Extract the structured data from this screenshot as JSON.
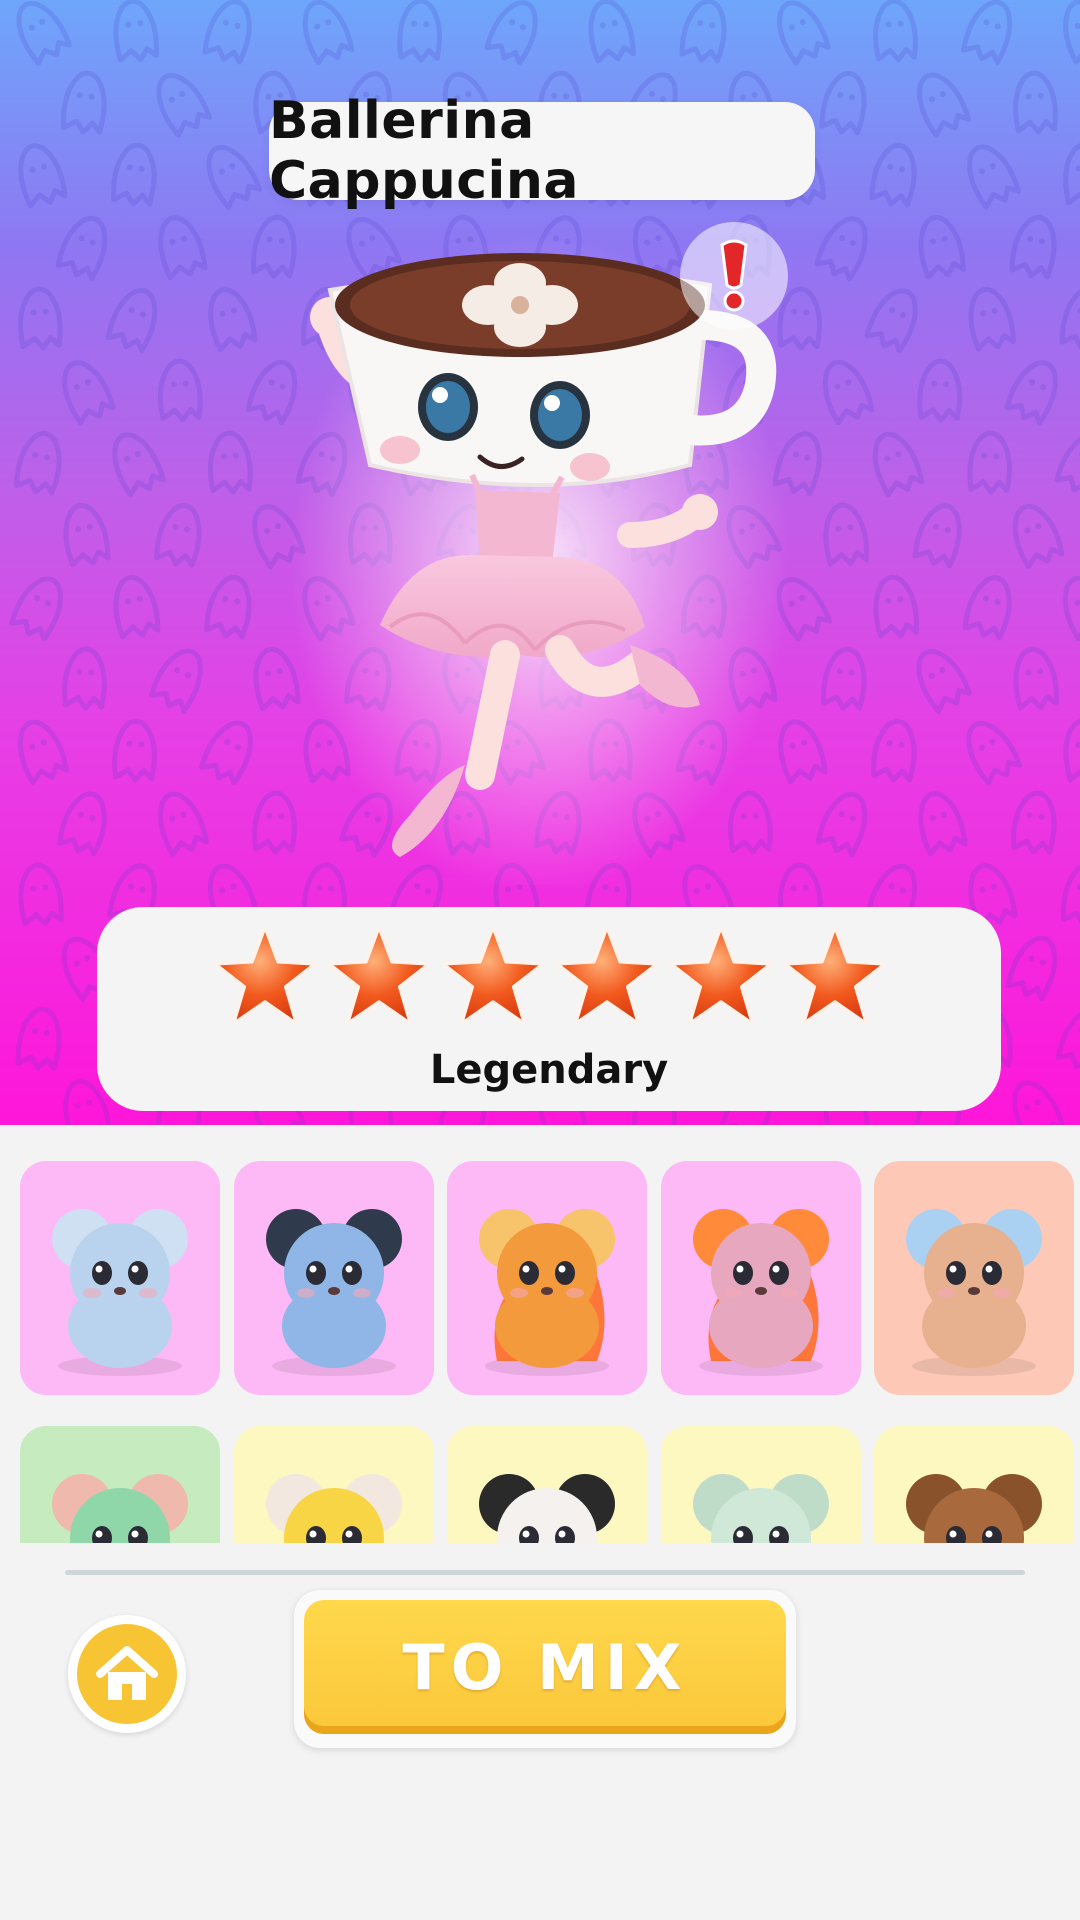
{
  "character": {
    "name": "Ballerina Cappucina",
    "rarity": "Legendary",
    "stars": 6,
    "image_icon": "ballerina-cappuccino-character",
    "info_icon": "exclamation-icon"
  },
  "colors": {
    "background_top": "#6ea6fb",
    "background_bottom": "#ff16d9",
    "star": "#f25a1e",
    "button": "#fbc73a",
    "panel": "#f4f4f5"
  },
  "collection": {
    "rows": [
      [
        {
          "icon": "ice-mouse",
          "bg": "#fdb9f6"
        },
        {
          "icon": "ice-panda",
          "bg": "#fdb9f6"
        },
        {
          "icon": "fire-tiger",
          "bg": "#fdb9f6"
        },
        {
          "icon": "fire-bird",
          "bg": "#fdb9f6"
        },
        {
          "icon": "ice-fox",
          "bg": "#fec8b6"
        }
      ],
      [
        {
          "icon": "green-mouse",
          "bg": "#c6ebbe"
        },
        {
          "icon": "strawberry-chick",
          "bg": "#fdf7c0"
        },
        {
          "icon": "tiger-cub",
          "bg": "#fdf7c0"
        },
        {
          "icon": "mint-mouse",
          "bg": "#fdf7c0"
        },
        {
          "icon": "brown-bear",
          "bg": "#fdf7c0"
        }
      ]
    ]
  },
  "actions": {
    "home_icon": "home-icon",
    "mix_label": "TO MIX"
  }
}
